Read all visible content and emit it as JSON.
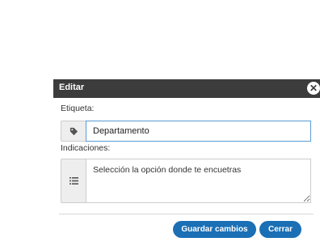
{
  "dialog": {
    "title": "Editar",
    "close_icon": "close-icon"
  },
  "form": {
    "label_label": "Etiqueta:",
    "label_value": "Departamento",
    "label_icon": "tag-icon",
    "instructions_label": "Indicaciones:",
    "instructions_value": "Selección la opción donde te encuetras",
    "instructions_icon": "list-icon"
  },
  "actions": {
    "save_label": "Guardar cambios",
    "close_label": "Cerrar"
  },
  "colors": {
    "titlebar": "#3c3c3c",
    "button": "#1a6fb5",
    "input_focus_border": "#5b9bd5"
  }
}
